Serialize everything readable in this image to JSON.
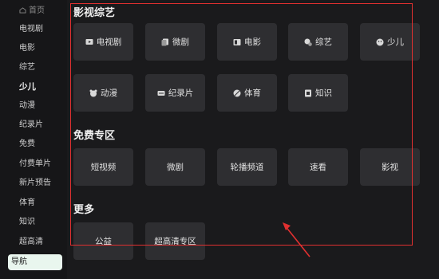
{
  "sidebar": {
    "home": "首页",
    "items": [
      "电视剧",
      "电影",
      "综艺",
      "少儿",
      "动漫",
      "纪录片",
      "免费",
      "付费单片",
      "新片预告",
      "体育",
      "知识",
      "超高清"
    ],
    "selected": "导航"
  },
  "sections": [
    {
      "title": "影视综艺",
      "tiles": [
        {
          "label": "电视剧",
          "icon": "tv-icon"
        },
        {
          "label": "微剧",
          "icon": "micro-drama-icon"
        },
        {
          "label": "电影",
          "icon": "film-icon"
        },
        {
          "label": "综艺",
          "icon": "variety-icon"
        },
        {
          "label": "少儿",
          "icon": "kids-icon"
        },
        {
          "label": "动漫",
          "icon": "anime-icon"
        },
        {
          "label": "纪录片",
          "icon": "documentary-icon"
        },
        {
          "label": "体育",
          "icon": "sports-icon"
        },
        {
          "label": "知识",
          "icon": "knowledge-icon"
        }
      ]
    },
    {
      "title": "免费专区",
      "tiles": [
        {
          "label": "短视频"
        },
        {
          "label": "微剧"
        },
        {
          "label": "轮播频道"
        },
        {
          "label": "速看"
        },
        {
          "label": "影视"
        }
      ]
    },
    {
      "title": "更多",
      "tiles": [
        {
          "label": "公益"
        },
        {
          "label": "超高清专区"
        }
      ]
    }
  ],
  "colors": {
    "highlight_box": "#e03030",
    "selected_bg": "#e9f6ee",
    "tile_bg": "#2e2e31"
  }
}
